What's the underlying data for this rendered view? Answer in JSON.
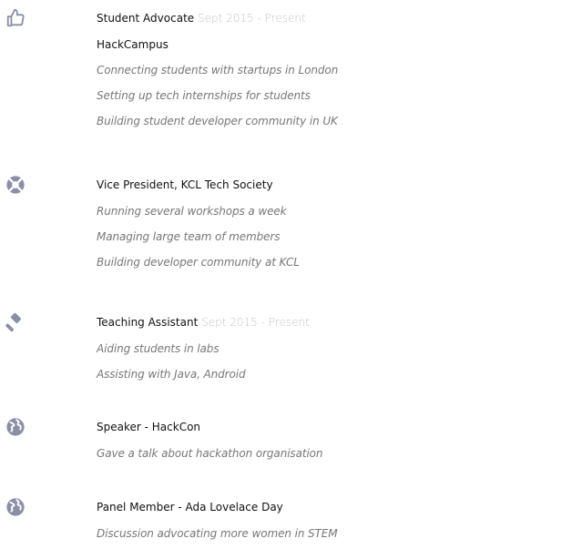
{
  "entries": [
    {
      "icon": "thumbs-up-icon",
      "title": "Student Advocate",
      "date": "Sept 2015 - Present",
      "org": "HackCampus",
      "details": [
        "Connecting students with startups in London",
        "Setting up tech internships for students",
        "Building student developer community in UK"
      ]
    },
    {
      "icon": "life-ring-icon",
      "title": "Vice President, KCL Tech Society",
      "details": [
        "Running several workshops a week",
        "Managing large team of members",
        "Building developer community at KCL"
      ]
    },
    {
      "icon": "gavel-icon",
      "title": "Teaching Assistant",
      "date": "Sept 2015 - Present",
      "details": [
        "Aiding students in labs",
        "Assisting with Java, Android"
      ]
    },
    {
      "icon": "globe-icon",
      "title": "Speaker - HackCon",
      "details": [
        "Gave a talk about hackathon organisation"
      ]
    },
    {
      "icon": "globe-icon",
      "title": "Panel Member - Ada Lovelace Day",
      "details": [
        "Discussion advocating more women in STEM"
      ]
    }
  ],
  "colors": {
    "icon": "#8a8fa6",
    "title": "#111111",
    "date": "#c4c4c4",
    "detail": "#777777"
  }
}
